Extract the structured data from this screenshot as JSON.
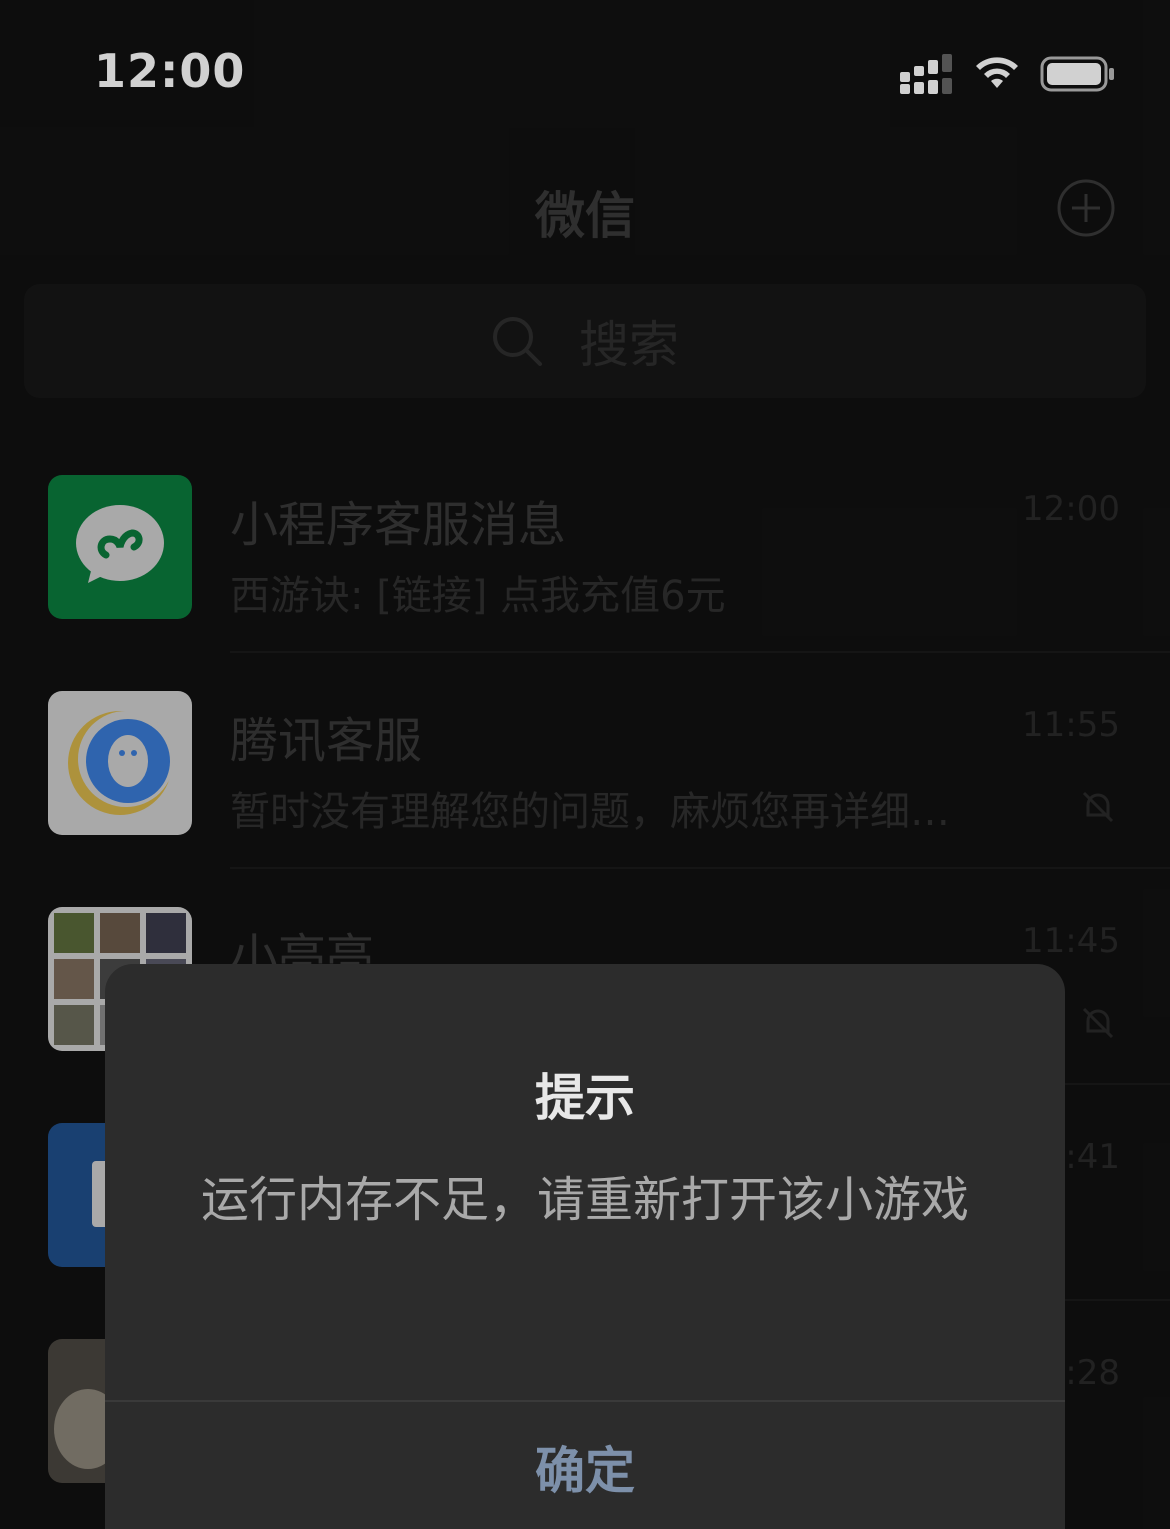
{
  "status_bar": {
    "time": "12:00",
    "icons": [
      "signal-icon",
      "wifi-icon",
      "battery-icon"
    ]
  },
  "nav": {
    "title": "微信",
    "add_icon": "plus-circle-icon"
  },
  "search": {
    "placeholder": "搜索",
    "icon": "search-icon"
  },
  "chats": [
    {
      "name": "小程序客服消息",
      "preview": "西游诀: [链接] 点我充值6元",
      "time": "12:00",
      "muted": false,
      "avatar": "mini-program-icon"
    },
    {
      "name": "腾讯客服",
      "preview": "暂时没有理解您的问题，麻烦您再详细…",
      "time": "11:55",
      "muted": true,
      "avatar": "tencent-service-icon"
    },
    {
      "name": "小亮亮",
      "preview": "",
      "time": "11:45",
      "muted": true,
      "avatar": "group-avatar"
    },
    {
      "name": "",
      "preview": "",
      "time": ":41",
      "muted": false,
      "avatar": "document-avatar"
    },
    {
      "name": "",
      "preview": "",
      "time": ":28",
      "muted": false,
      "avatar": "photo-avatar"
    }
  ],
  "dialog": {
    "title": "提示",
    "message": "运行内存不足，请重新打开该小游戏",
    "confirm_label": "确定"
  },
  "colors": {
    "background": "#111111",
    "dialog_background": "#2c2c2c",
    "confirm_text": "#7d90aa",
    "mini_program_green": "#0a7a3c",
    "tencent_blue": "#3a7bd5"
  }
}
